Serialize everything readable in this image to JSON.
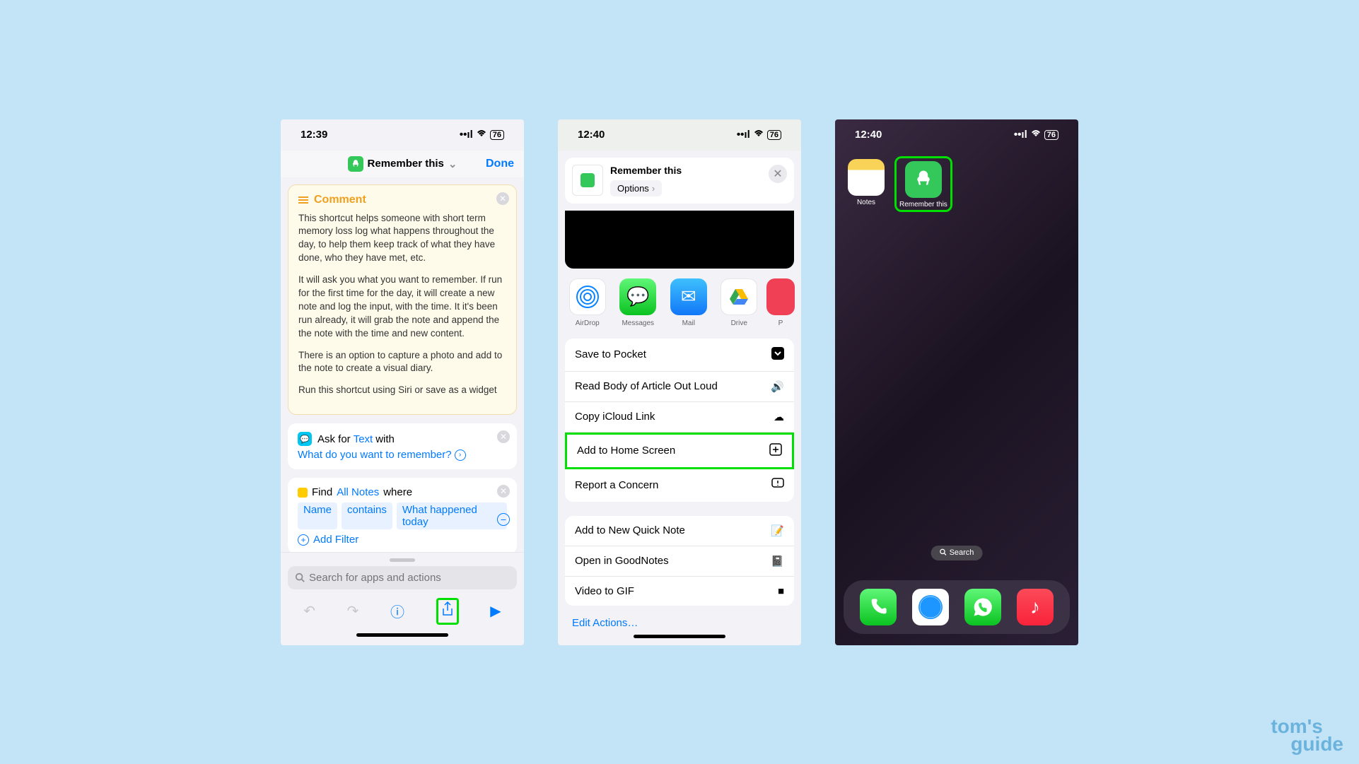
{
  "status": {
    "time1": "12:39",
    "time2": "12:40",
    "time3": "12:40",
    "battery": "76"
  },
  "phone1": {
    "title": "Remember this",
    "done": "Done",
    "comment_label": "Comment",
    "comment_p1": "This shortcut helps someone with short term memory loss log what happens throughout the day, to help them keep track of what they have done, who they have met, etc.",
    "comment_p2": "It will ask you what you want to remember. If run for the first time for the day, it will create a new note and log the input, with the time. It it's been run already, it will grab the note and append the the note with the time and new content.",
    "comment_p3": "There is an option to capture a photo and add to the note to create a visual diary.",
    "comment_p4": "Run this shortcut using Siri or save as a widget",
    "ask_prefix": "Ask for",
    "ask_type": "Text",
    "ask_with": "with",
    "ask_prompt": "What do you want to remember?",
    "find_label": "Find",
    "find_source": "All Notes",
    "find_where": "where",
    "filter_name": "Name",
    "filter_op": "contains",
    "filter_val": "What happened today",
    "add_filter": "Add Filter",
    "search_placeholder": "Search for apps and actions"
  },
  "phone2": {
    "title": "Remember this",
    "options": "Options",
    "apps": [
      {
        "name": "AirDrop"
      },
      {
        "name": "Messages"
      },
      {
        "name": "Mail"
      },
      {
        "name": "Drive"
      },
      {
        "name": "P"
      }
    ],
    "actions1": [
      "Save to Pocket",
      "Read Body of Article Out Loud",
      "Copy iCloud Link",
      "Add to Home Screen",
      "Report a Concern"
    ],
    "actions2": [
      "Add to New Quick Note",
      "Open in GoodNotes",
      "Video to GIF"
    ],
    "edit": "Edit Actions…"
  },
  "phone3": {
    "apps": [
      {
        "name": "Notes"
      },
      {
        "name": "Remember this"
      }
    ],
    "search": "Search"
  },
  "watermark": {
    "l1": "tom's",
    "l2": "guide"
  }
}
